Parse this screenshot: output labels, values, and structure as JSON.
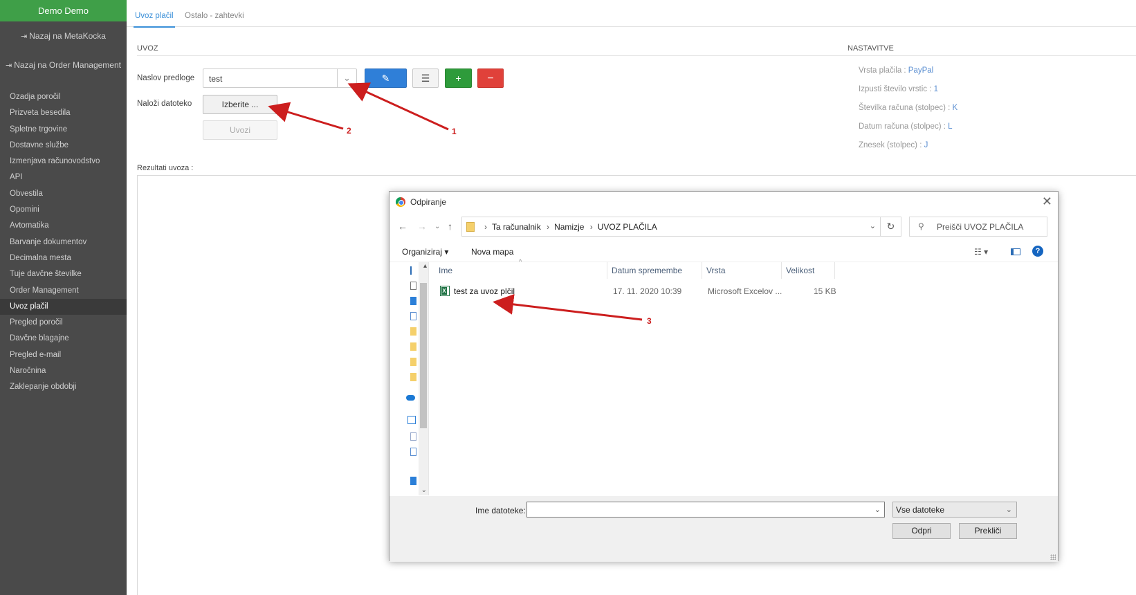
{
  "sidebar": {
    "user": "Demo Demo",
    "back_metakocka": "Nazaj na MetaKocka",
    "back_order": "Nazaj na Order Management",
    "items": [
      "Ozadja poročil",
      "Prizveta besedila",
      "Spletne trgovine",
      "Dostavne službe",
      "Izmenjava računovodstvo",
      "API",
      "Obvestila",
      "Opomini",
      "Avtomatika",
      "Barvanje dokumentov",
      "Decimalna mesta",
      "Tuje davčne številke",
      "Order Management",
      "Uvoz plačil",
      "Pregled poročil",
      "Davčne blagajne",
      "Pregled e-mail",
      "Naročnina",
      "Zaklepanje obdobji"
    ]
  },
  "tabs": {
    "uvoz": "Uvoz plačil",
    "ostalo": "Ostalo - zahtevki"
  },
  "form": {
    "section_title": "UVOZ",
    "naslov_label": "Naslov predloge",
    "naslov_value": "test",
    "nalozi_label": "Naloži datoteko",
    "izberite": "Izberite ...",
    "uvozi": "Uvozi",
    "rezultati_label": "Rezultati uvoza :"
  },
  "settings": {
    "title": "NASTAVITVE",
    "items": [
      {
        "label": "Vrsta plačila : ",
        "value": "PayPal"
      },
      {
        "label": "Izpusti število vrstic : ",
        "value": "1"
      },
      {
        "label": "Številka računa (stolpec) : ",
        "value": "K"
      },
      {
        "label": "Datum računa (stolpec) : ",
        "value": "L"
      },
      {
        "label": "Znesek (stolpec) : ",
        "value": "J"
      }
    ]
  },
  "annotations": [
    "1",
    "2",
    "3"
  ],
  "dialog": {
    "title": "Odpiranje",
    "breadcrumb": [
      "Ta računalnik",
      "Namizje",
      "UVOZ PLAČILA"
    ],
    "search_placeholder": "Preišči UVOZ PLAČILA",
    "organize": "Organiziraj",
    "new_folder": "Nova mapa",
    "columns": {
      "name": "Ime",
      "date": "Datum spremembe",
      "type": "Vrsta",
      "size": "Velikost"
    },
    "files": [
      {
        "name": "test za uvoz plčil",
        "date": "17. 11. 2020 10:39",
        "type": "Microsoft Excelov ...",
        "size": "15 KB"
      }
    ],
    "filename_label": "Ime datoteke:",
    "filename_value": "",
    "filetype": "Vse datoteke",
    "open": "Odpri",
    "cancel": "Prekliči"
  },
  "colors": {
    "green": "#3f9f48",
    "blue": "#2f7fd8",
    "red": "#e0413a",
    "arrow": "#cc1e1e"
  }
}
